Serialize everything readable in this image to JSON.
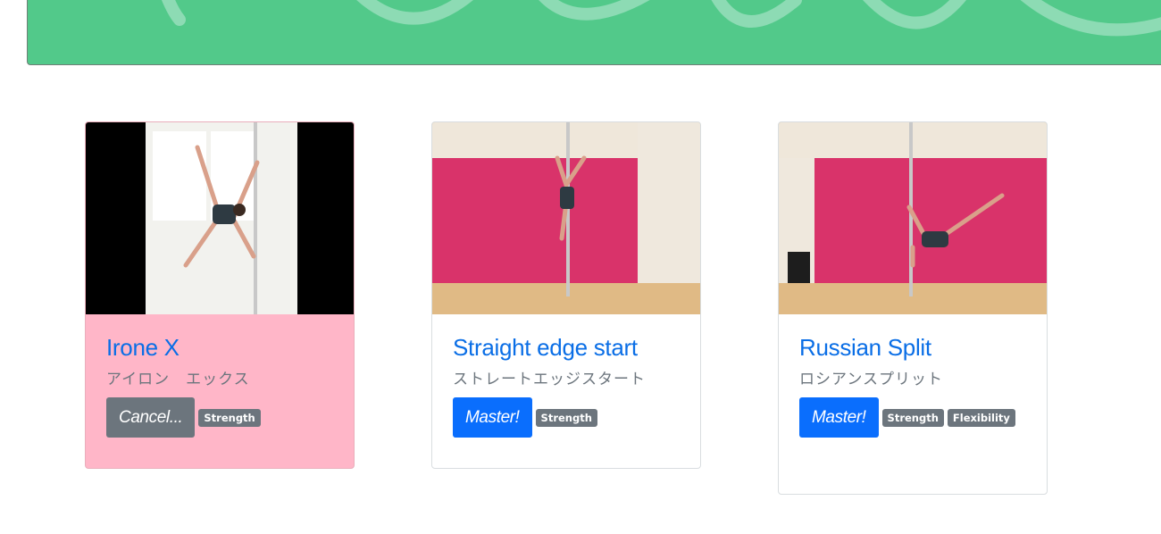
{
  "header": {
    "banner_color": "#52c98a"
  },
  "cards": [
    {
      "title": "Irone X",
      "subtitle": "アイロン　エックス",
      "button": "Cancel...",
      "button_style": "secondary",
      "tags": [
        "Strength"
      ],
      "highlight_color": "#ffb6c8",
      "image": "pole-move-photo-irone-x"
    },
    {
      "title": "Straight edge start",
      "subtitle": "ストレートエッジスタート",
      "button": "Master!",
      "button_style": "primary",
      "tags": [
        "Strength"
      ],
      "image": "pole-move-photo-straight-edge"
    },
    {
      "title": "Russian Split",
      "subtitle": "ロシアンスプリット",
      "button": "Master!",
      "button_style": "primary",
      "tags": [
        "Strength",
        "Flexibility"
      ],
      "image": "pole-move-photo-russian-split"
    }
  ],
  "colors": {
    "link": "#0a6efd",
    "badge": "#6c757d",
    "primary": "#0a6efd",
    "secondary": "#6c757d"
  }
}
